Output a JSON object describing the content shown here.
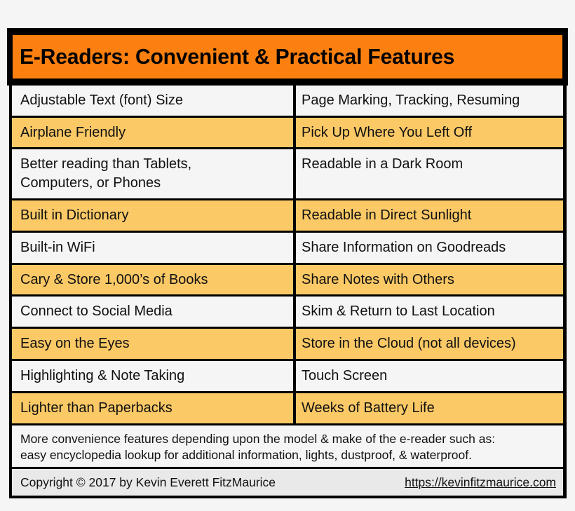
{
  "title": "E-Readers: Convenient & Practical Features",
  "colors": {
    "header_orange": "#fb8010",
    "row_yellow": "#fbc966",
    "row_white": "#f5f5f5",
    "border_black": "#000000"
  },
  "rows": [
    {
      "left": "Adjustable Text (font) Size",
      "right": "Page Marking, Tracking, Resuming",
      "style": "white"
    },
    {
      "left": "Airplane Friendly",
      "right": "Pick Up Where You Left Off",
      "style": "yellow"
    },
    {
      "left": "Better reading than Tablets,",
      "left_line2": "Computers, or Phones",
      "right": "Readable in a Dark Room",
      "style": "white"
    },
    {
      "left": "Built in Dictionary",
      "right": "Readable in Direct Sunlight",
      "style": "yellow"
    },
    {
      "left": "Built-in WiFi",
      "right": "Share Information on Goodreads",
      "style": "white"
    },
    {
      "left": "Cary & Store 1,000’s of Books",
      "right": "Share Notes with Others",
      "style": "yellow"
    },
    {
      "left": "Connect to Social Media",
      "right": "Skim & Return to Last Location",
      "style": "white"
    },
    {
      "left": "Easy on the Eyes",
      "right": "Store in the Cloud (not all devices)",
      "style": "yellow"
    },
    {
      "left": "Highlighting & Note Taking",
      "right": "Touch Screen",
      "style": "white"
    },
    {
      "left": "Lighter than Paperbacks",
      "right": "Weeks of Battery Life",
      "style": "yellow"
    }
  ],
  "note": {
    "line1": "More convenience features depending upon the model & make of the e-reader such as:",
    "line2": "easy encyclopedia lookup for additional information, lights, dustproof, & waterproof."
  },
  "footer": {
    "copyright": "Copyright © 2017 by Kevin Everett FitzMaurice",
    "link": "https://kevinfitzmaurice.com"
  }
}
